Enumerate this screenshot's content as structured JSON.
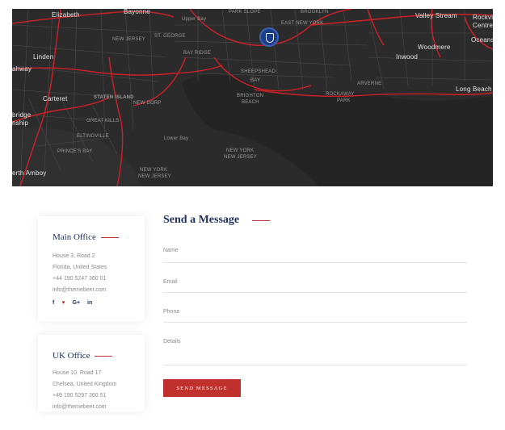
{
  "map": {
    "labels": {
      "elizabeth": "Elizabeth",
      "bayonne": "Bayonne",
      "park_slope": "PARK SLOPE",
      "brooklyn": "BROOKLYN",
      "valley_stream": "Valley Stream",
      "rockville": "Rockvill",
      "centre": "Centre",
      "oceanside": "Oceansid",
      "new_jersey_1": "NEW JERSEY",
      "st_george": "ST. GEORGE",
      "east_new_york": "EAST NEW YORK",
      "woodmere": "Woodmere",
      "linden": "Linden",
      "rahway": "ahway",
      "bay_ridge": "BAY RIDGE",
      "inwood": "Inwood",
      "sheepshead": "SHEEPSHEAD",
      "bay": "BAY",
      "arverne": "ARVERNE",
      "long_beach": "Long Beach",
      "carteret": "Carteret",
      "staten_island": "STATEN ISLAND",
      "new_dorp": "NEW DORP",
      "brighton": "BRIGHTON",
      "beach": "BEACH",
      "rockaway": "ROCKAWAY",
      "park": "PARK",
      "bridge": "bridge",
      "nship": "nship",
      "great_kills": "GREAT KILLS",
      "eltingville": "ELTINGVILLE",
      "princes_bay": "PRINCE'S BAY",
      "lower_bay": "Lower Bay",
      "new_york": "NEW YORK",
      "new_jersey_2": "NEW JERSEY",
      "new_york_2": "NEW YORK",
      "new_jersey_3": "NEW JERSEY",
      "perth_amboy": "erth Amboy",
      "upper_bay": "Upper Bay"
    }
  },
  "offices": [
    {
      "title": "Main Office",
      "lines": [
        "House 3, Road 2",
        "Florida, United States",
        "+44 190 5247 360 01",
        "info@themebeer.com"
      ],
      "social": [
        "f",
        "♥",
        "G+",
        "in"
      ]
    },
    {
      "title": "UK Office",
      "lines": [
        "House 10, Road 17",
        "Chelsea, United Kingdom",
        "+49 190 5297 360 51",
        "info@themebeer.com"
      ]
    }
  ],
  "form": {
    "title": "Send a Message",
    "name_label": "Name",
    "email_label": "Email",
    "phone_label": "Phone",
    "details_label": "Details",
    "submit_label": "SEND MESSAGE"
  },
  "colors": {
    "brand_navy": "#1e2f5c",
    "accent_red": "#c0312d",
    "map_bg": "#2b2b2b",
    "map_road": "#d0202a"
  },
  "icons": {
    "map_marker": "shield-crest-icon",
    "facebook": "facebook-icon",
    "twitter": "heart-icon",
    "google_plus": "google-plus-icon",
    "linkedin": "linkedin-icon"
  }
}
